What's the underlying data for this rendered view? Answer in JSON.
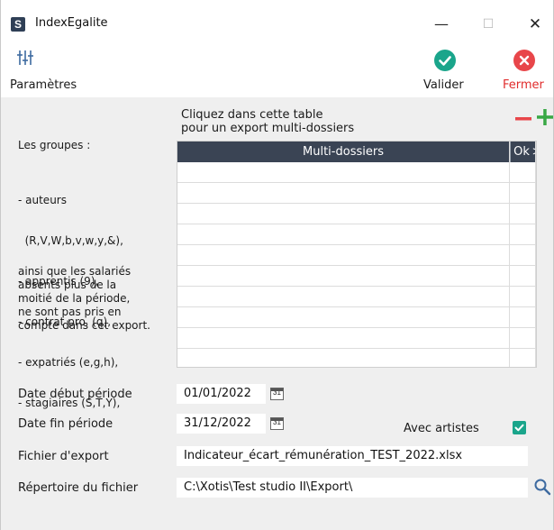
{
  "window": {
    "title": "IndexEgalite",
    "app_icon_letter": "S",
    "minimize": "—",
    "maximize": "☐",
    "close": "✕"
  },
  "toolbar": {
    "settings_label": "Paramètres",
    "validate_label": "Valider",
    "close_label": "Fermer",
    "colors": {
      "validate": "#1aa58b",
      "close": "#e8464a",
      "close_text": "#e02b2b"
    }
  },
  "hint": {
    "line1": "Cliquez dans cette table",
    "line2": "pour un export multi-dossiers"
  },
  "table": {
    "columns": [
      "Multi-dossiers",
      "Ok",
      ">"
    ],
    "rows": [],
    "remove_icon": "minus-icon",
    "add_icon": "plus-icon"
  },
  "groups_text": {
    "title": "Les groupes :",
    "items": [
      "- auteurs",
      "  (R,V,W,b,v,w,y,&),",
      "- apprentis (9),",
      "- contrat pro. (q),",
      "- expatriés (e,g,h),",
      "- stagiaires (S,T,Y),"
    ],
    "note": [
      "ainsi que les salariés",
      "absents plus de la",
      "moitié de la période,",
      "ne sont pas pris en",
      "compte dans cet export."
    ]
  },
  "form": {
    "start_label": "Date début période",
    "start_value": "01/01/2022",
    "end_label": "Date fin période",
    "end_value": "31/12/2022",
    "calendar_day": "31",
    "artists_label": "Avec artistes",
    "artists_checked": true,
    "file_label": "Fichier d'export",
    "file_value": "Indicateur_écart_rémunération_TEST_2022.xlsx",
    "dir_label": "Répertoire du fichier",
    "dir_value": "C:\\Xotis\\Test studio II\\Export\\"
  }
}
